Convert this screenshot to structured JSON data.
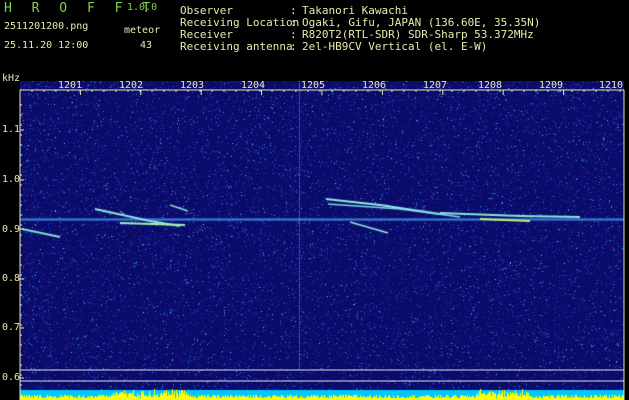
{
  "app": {
    "title": "H R O F F T",
    "version": "1.0.0"
  },
  "file_name": "2511201200.png",
  "datetime": "25.11.20 12:00",
  "meteor": {
    "label": "meteor",
    "count": "43"
  },
  "info": [
    {
      "key": "Observer",
      "value": "Takanori Kawachi"
    },
    {
      "key": "Receiving Location",
      "value": "Ogaki, Gifu, JAPAN (136.60E, 35.35N)"
    },
    {
      "key": "Receiver",
      "value": "R820T2(RTL-SDR) SDR-Sharp 53.372MHz"
    },
    {
      "key": "Receiving antenna",
      "value": "2el-HB9CV Vertical (el. E-W)"
    }
  ],
  "y_unit": "kHz",
  "y_ticks": [
    "1.1",
    "1.0",
    "0.9",
    "0.8",
    "0.7",
    "0.6"
  ],
  "x_ticks": [
    "1201",
    "1202",
    "1203",
    "1204",
    "1205",
    "1206",
    "1207",
    "1208",
    "1209",
    "1210"
  ],
  "colors": {
    "label": "#e9e9b0",
    "title": "#7fd24a",
    "background": "#0b0b6a",
    "level_bar": "#00c8ff",
    "level_peak": "#ffff00"
  }
}
